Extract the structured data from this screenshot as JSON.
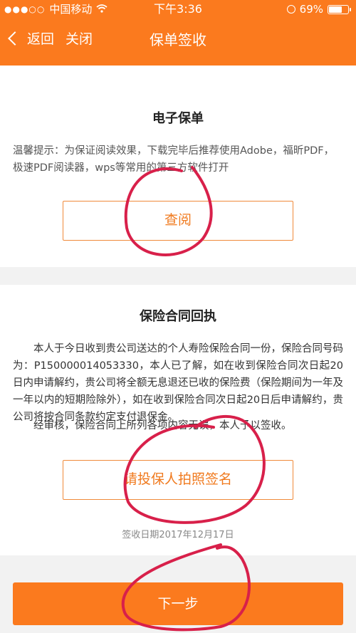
{
  "status_bar": {
    "carrier": "中国移动",
    "time": "下午3:36",
    "battery": "69%"
  },
  "nav": {
    "back_label": "返回",
    "close_label": "关闭",
    "title": "保单签收"
  },
  "policy_card": {
    "title": "电子保单",
    "tip": "温馨提示：为保证阅读效果，下载完毕后推荐使用Adobe，福昕PDF，极速PDF阅读器，wps等常用的第三方软件打开",
    "view_button": "查阅"
  },
  "receipt_card": {
    "title": "保险合同回执",
    "paragraph1": "本人于今日收到贵公司送达的个人寿险保险合同一份，保险合同号码为：P150000014053330，本人已了解，如在收到保险合同次日起20日内申请解约，贵公司将全额无息退还已收的保险费（保险期间为一年及一年以内的短期险除外），如在收到保险合同次日起20日后申请解约，贵公司将按合同条款约定支付退保金。",
    "paragraph2": "经审核，保险合同上所列各项内容无误，本人予以签收。",
    "sign_button": "请投保人拍照签名",
    "sign_date": "签收日期2017年12月17日"
  },
  "footer": {
    "next_button": "下一步"
  },
  "colors": {
    "brand_orange": "#fb7a1e",
    "annotation_red": "#d8204a"
  }
}
